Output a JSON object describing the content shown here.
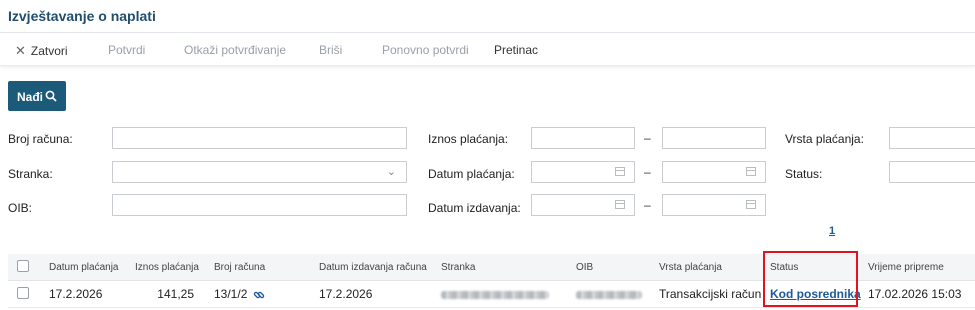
{
  "page": {
    "title": "Izvještavanje o naplati"
  },
  "toolbar": {
    "close": "Zatvori",
    "confirm": "Potvrdi",
    "cancel_confirm": "Otkaži potvrđivanje",
    "delete": "Briši",
    "reconfirm": "Ponovno potvrdi",
    "inbox": "Pretinac"
  },
  "search": {
    "button_label": "Nađi"
  },
  "filters": {
    "invoice_number": "Broj računa:",
    "party": "Stranka:",
    "oib": "OIB:",
    "amount": "Iznos plaćanja:",
    "payment_date": "Datum plaćanja:",
    "issue_date": "Datum izdavanja:",
    "payment_type": "Vrsta plaćanja:",
    "status": "Status:",
    "range_dash": "–"
  },
  "pagination": {
    "page": "1"
  },
  "table": {
    "headers": [
      "Datum plaćanja",
      "Iznos plaćanja",
      "Broj računa",
      "Datum izdavanja računa",
      "Stranka",
      "OIB",
      "Vrsta plaćanja",
      "Status",
      "Vrijeme pripreme"
    ],
    "rows": [
      {
        "payment_date": "17.2.2026",
        "amount": "141,25",
        "invoice_number": "13/1/2",
        "issue_date": "17.2.2026",
        "payment_type": "Transakcijski račun",
        "status": "Kod posrednika",
        "prepared_at": "17.02.2026 15:03"
      }
    ]
  },
  "colors": {
    "accent": "#1c5a7a",
    "title": "#1f4e6e",
    "link": "#1c5a9a",
    "highlight": "#e0141e"
  },
  "icons": [
    "close-icon",
    "search-icon",
    "chevron-down-icon",
    "calendar-icon",
    "link-icon"
  ]
}
